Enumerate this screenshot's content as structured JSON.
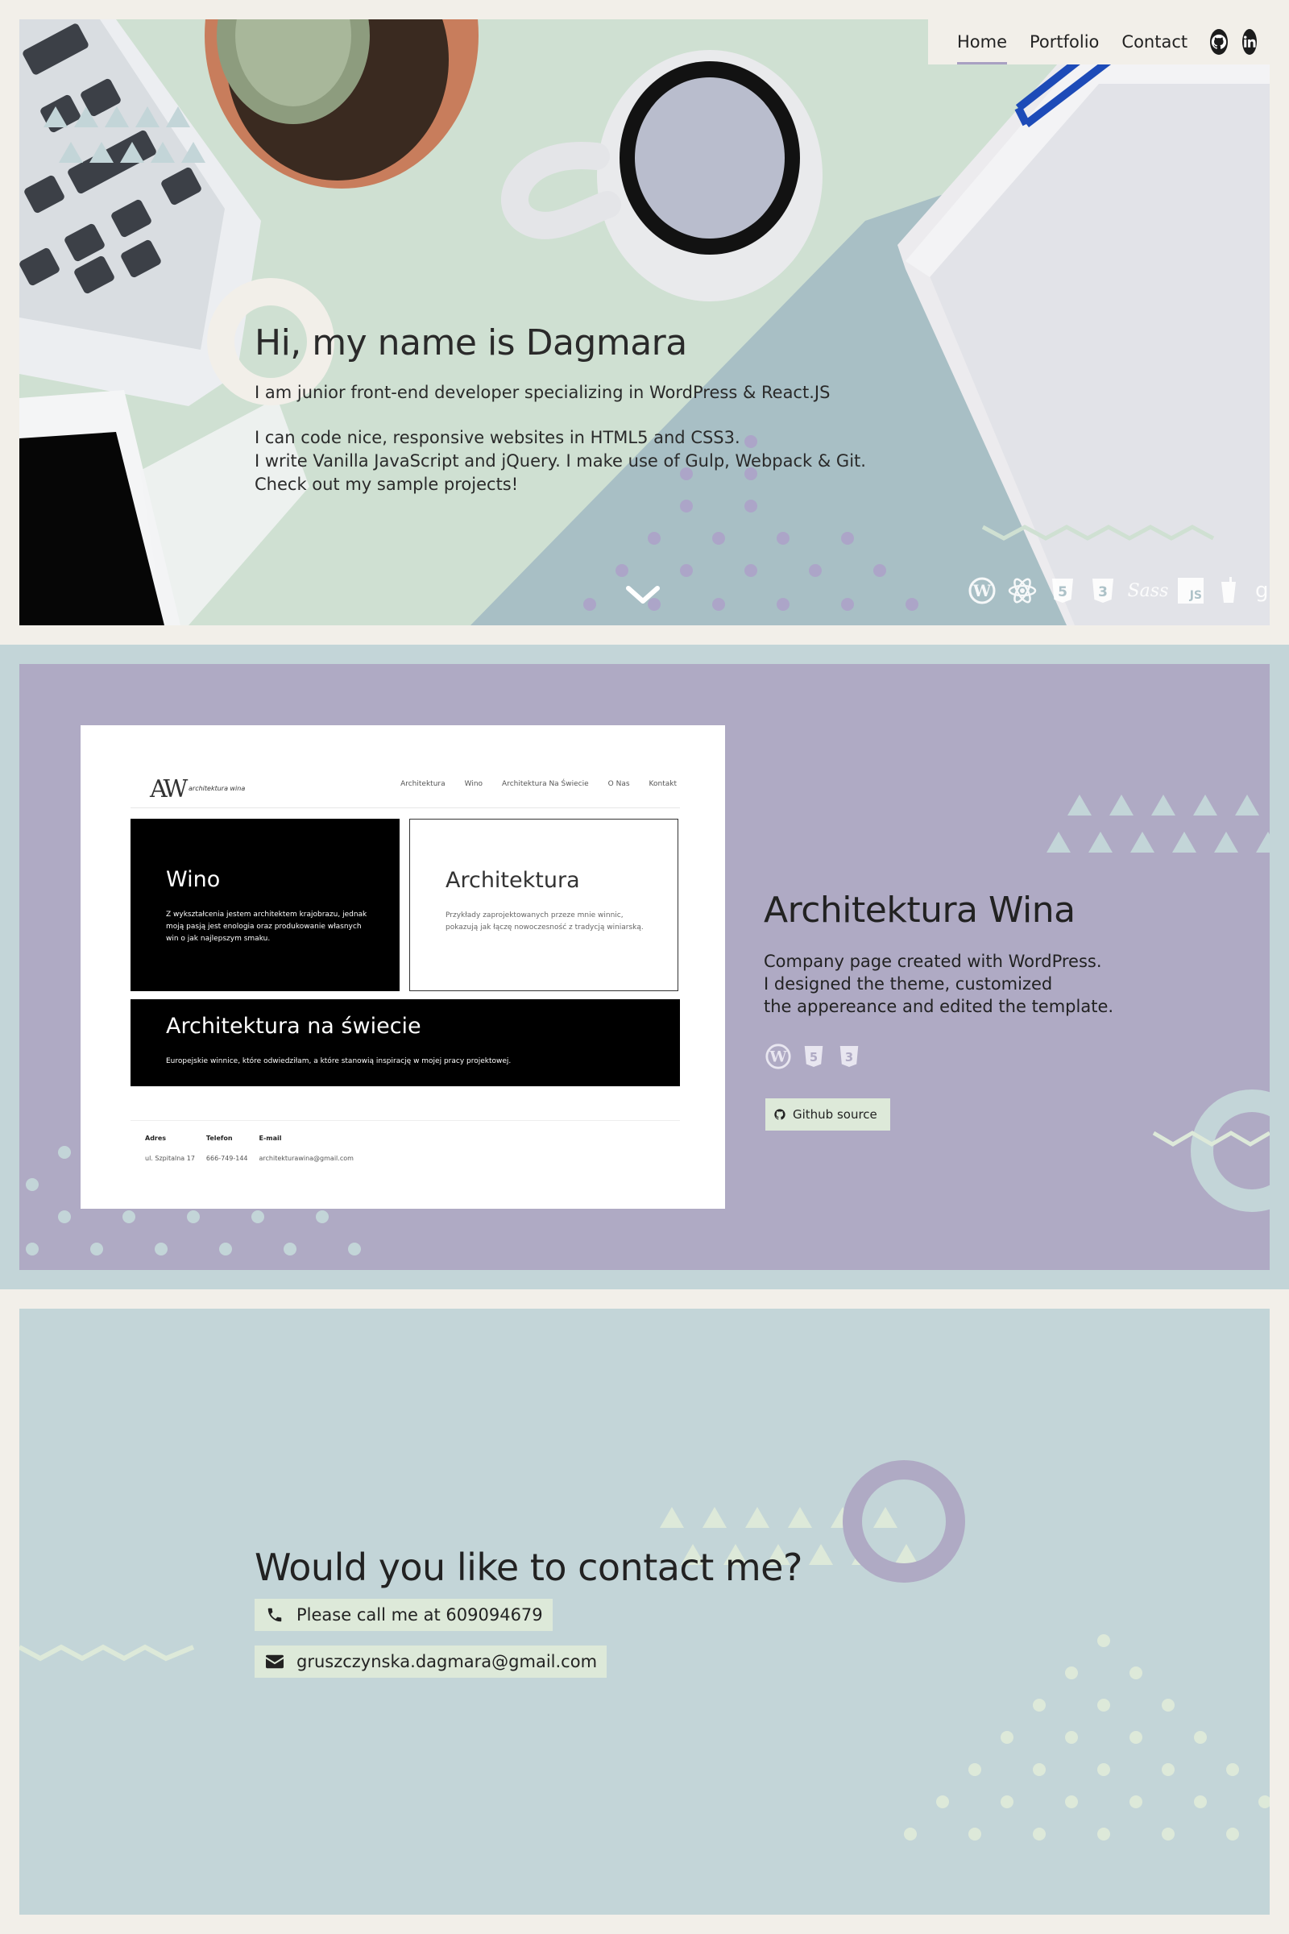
{
  "nav": {
    "links": [
      "Home",
      "Portfolio",
      "Contact"
    ],
    "icons": [
      "github-icon",
      "linkedin-icon"
    ]
  },
  "hero": {
    "title": "Hi, my name is Dagmara",
    "line1": "I am junior front-end developer specializing in WordPress & React.JS",
    "line2": "I can code nice, responsive websites in HTML5 and CSS3.",
    "line3": "I write Vanilla JavaScript and jQuery. I make use of Gulp, Webpack & Git.",
    "line4": "Check out my sample projects!",
    "tech_icons": [
      "wordpress-icon",
      "react-icon",
      "html5-icon",
      "css3-icon",
      "sass-icon",
      "js-icon",
      "gulp-icon",
      "git-icon"
    ],
    "tech_labels": {
      "sass": "Sass",
      "js": "JS",
      "git": "git"
    }
  },
  "portfolio": {
    "project": {
      "title": "Architektura Wina",
      "desc1": "Company page created with WordPress.",
      "desc2": "I designed the theme, customized",
      "desc3": "the appereance and edited the template.",
      "tech_icons": [
        "wordpress-icon",
        "html5-icon",
        "css3-icon"
      ],
      "button": "Github source"
    },
    "screenshot": {
      "logo": "AW",
      "logo_sub": "architektura wina",
      "nav": [
        "Architektura",
        "Wino",
        "Architektura Na Świecie",
        "O Nas",
        "Kontakt"
      ],
      "tile_wino_title": "Wino",
      "tile_wino_text": "Z wykształcenia jestem architektem krajobrazu, jednak moją pasją jest enologia oraz produkowanie własnych win o jak najlepszym smaku.",
      "tile_arch_title": "Architektura",
      "tile_arch_text": "Przykłady zaprojektowanych przeze mnie winnic, pokazują jak łączę nowoczesność z tradycją winiarską.",
      "tile_swiat_title": "Architektura na świecie",
      "tile_swiat_text": "Europejskie winnice, które odwiedziłam, a które stanowią inspirację w mojej pracy projektowej.",
      "footer": {
        "adres_label": "Adres",
        "adres_value": "ul. Szpitalna 17",
        "telefon_label": "Telefon",
        "telefon_value": "666-749-144",
        "email_label": "E-mail",
        "email_value": "architekturawina@gmail.com"
      }
    }
  },
  "contact": {
    "title": "Would you like to contact me?",
    "phone": "Please call me at 609094679",
    "email": "gruszczynska.dagmara@gmail.com"
  },
  "colors": {
    "page_bg": "#f2efe9",
    "hero_green": "#cfe0d2",
    "hero_blue": "#a9c0c6",
    "lavender": "#afaac4",
    "teal": "#c3d5d8",
    "mint": "#dde9d9",
    "purple_accent": "#a9a0c2"
  }
}
